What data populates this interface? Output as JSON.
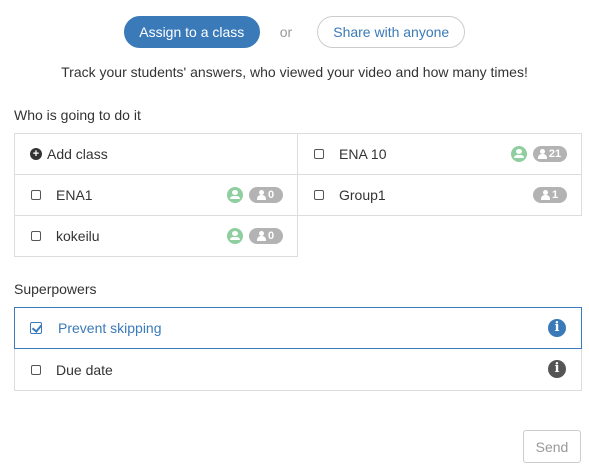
{
  "top": {
    "assign_label": "Assign to a class",
    "or_label": "or",
    "share_label": "Share with anyone"
  },
  "tagline": "Track your students' answers, who viewed your video and how many times!",
  "who_section": {
    "title": "Who is going to do it",
    "add_class_label": "Add class",
    "classes": [
      {
        "name": "ENA 10",
        "has_teacher": true,
        "count": "21"
      },
      {
        "name": "ENA1",
        "has_teacher": true,
        "count": "0"
      },
      {
        "name": "Group1",
        "has_teacher": false,
        "count": "1"
      },
      {
        "name": "kokeilu",
        "has_teacher": true,
        "count": "0"
      }
    ]
  },
  "superpowers": {
    "title": "Superpowers",
    "items": [
      {
        "label": "Prevent skipping",
        "checked": true
      },
      {
        "label": "Due date",
        "checked": false
      }
    ]
  },
  "send_label": "Send",
  "colors": {
    "accent": "#3a7ab8",
    "teacher_badge": "#8fcf9f",
    "count_badge": "#b3b3b3",
    "border": "#dddddd"
  }
}
